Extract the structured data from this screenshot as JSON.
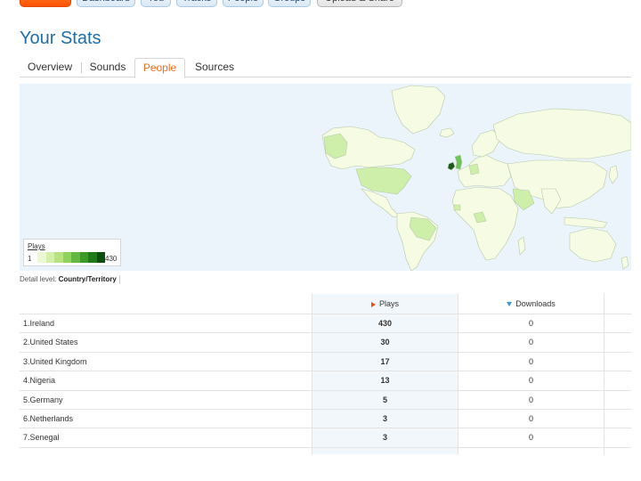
{
  "nav": {
    "items": [
      "Dashboard",
      "You",
      "Tracks",
      "People",
      "Groups"
    ],
    "upload_label": "Upload & Share"
  },
  "page": {
    "title": "Your Stats"
  },
  "tabs": [
    {
      "label": "Overview",
      "active": false
    },
    {
      "label": "Sounds",
      "active": false
    },
    {
      "label": "People",
      "active": true
    },
    {
      "label": "Sources",
      "active": false
    }
  ],
  "map": {
    "legend": {
      "label": "Plays",
      "min": "1",
      "max": "430",
      "colors": [
        "#ecf7d6",
        "#d3f0a8",
        "#b6e380",
        "#8fd35c",
        "#64b83f",
        "#3d9a2a",
        "#1f7a1a",
        "#0e4d0e"
      ]
    },
    "colors": {
      "water": "#eaf4fa",
      "land": "#f6fbe3",
      "border": "#b9c9a8",
      "low": "#cdefaa",
      "mid": "#6fc35a",
      "high": "#1d5a1d"
    }
  },
  "detail": {
    "label": "Detail level:",
    "value": "Country/Territory"
  },
  "table": {
    "headers": {
      "plays": "Plays",
      "downloads": "Downloads"
    },
    "rows": [
      {
        "country": "1.Ireland",
        "plays": "430",
        "downloads": "0"
      },
      {
        "country": "2.United States",
        "plays": "30",
        "downloads": "0"
      },
      {
        "country": "3.United Kingdom",
        "plays": "17",
        "downloads": "0"
      },
      {
        "country": "4.Nigeria",
        "plays": "13",
        "downloads": "0"
      },
      {
        "country": "5.Germany",
        "plays": "5",
        "downloads": "0"
      },
      {
        "country": "6.Netherlands",
        "plays": "3",
        "downloads": "0"
      },
      {
        "country": "7.Senegal",
        "plays": "3",
        "downloads": "0"
      }
    ]
  }
}
